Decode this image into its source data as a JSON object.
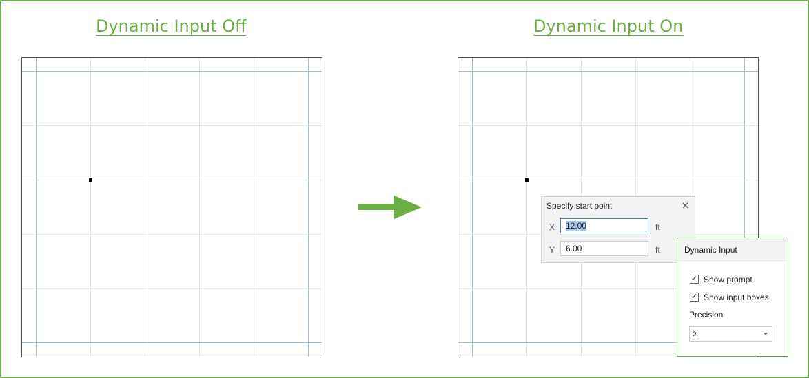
{
  "headings": {
    "off": "Dynamic Input Off",
    "on": "Dynamic Input On"
  },
  "prompt_dialog": {
    "title": "Specify start point",
    "close_icon": "close-icon",
    "x_label": "X",
    "x_value": "12.00",
    "y_label": "Y",
    "y_value": "6.00",
    "unit": "ft"
  },
  "settings_panel": {
    "title": "Dynamic Input",
    "show_prompt": {
      "label": "Show prompt",
      "checked": true
    },
    "show_input_boxes": {
      "label": "Show input boxes",
      "checked": true
    },
    "precision_label": "Precision",
    "precision_value": "2"
  },
  "colors": {
    "accent_green": "#6aae45",
    "frame_green": "#6aa84f",
    "grid": "#dfe6ee",
    "grid_border": "#9fc1da",
    "selection": "#a9cdf1"
  },
  "icons": {
    "arrow": "right-arrow-icon",
    "check": "checkmark-icon",
    "dropdown": "chevron-down-icon"
  }
}
